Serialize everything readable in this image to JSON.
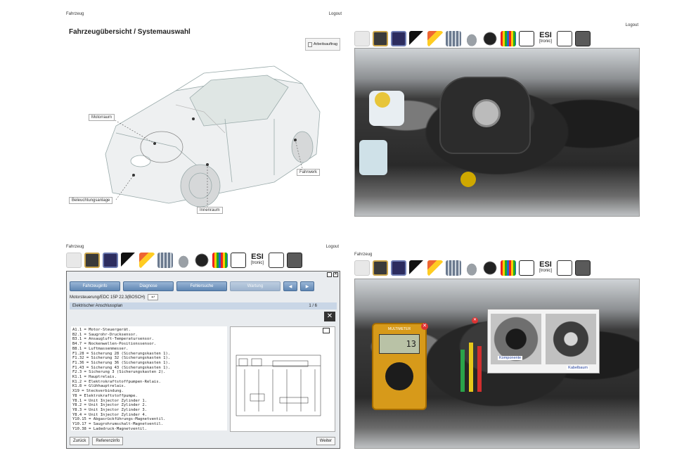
{
  "topleft": {
    "nav_left": "Fahrzeug",
    "nav_right": "Logout",
    "title": "Fahrzeugübersicht / Systemauswahl",
    "order_button": "Arbeitsauftrag",
    "labels": {
      "engine": "Motorraum",
      "lighting": "Beleuchtungsanlage",
      "interior": "Innenraum",
      "chassis": "Fahrwerk"
    }
  },
  "topright": {
    "nav_right": "Logout"
  },
  "bottomleft": {
    "nav_left": "Fahrzeug",
    "nav_right": "Logout",
    "tabs": [
      "Fahrzeuginfo",
      "Diagnose",
      "Fehlersuche",
      "Wartung"
    ],
    "module": "Motorsteuerung/EDC 15P 22.3(BOSCH)",
    "section": "Elektrischer Anschlussplan",
    "page": "1 / 6",
    "legend": [
      "A1.1 = Motor-Steuergerät.",
      "B2.1 = Saugrohr-Drucksensor.",
      "B3.1 = Ansaugluft-Temperatursensor.",
      "B4.7 = Nockenwellen-Positionssensor.",
      "B8.1 = Luftmassenmesser.",
      "F1.28 = Sicherung 28 (Sicherungskasten 1).",
      "F1.32 = Sicherung 32 (Sicherungskasten 1).",
      "F1.36 = Sicherung 36 (Sicherungskasten 1).",
      "F1.43 = Sicherung 43 (Sicherungskasten 1).",
      "F2.3 = Sicherung 3 (Sicherungskasten 2).",
      "K1.1 = Hauptrelais.",
      "K1.2 = Elektrokraftstoffpumpen-Relais.",
      "K1.8 = Glühhauptrelais.",
      "X19 = Steckverbindung.",
      "Y8 = Elektrokraftstoffpumpe.",
      "Y8.1 = Unit Injector Zylinder 1.",
      "Y8.2 = Unit Injector Zylinder 2.",
      "Y8.3 = Unit Injector Zylinder 3.",
      "Y8.4 = Unit Injector Zylinder 4.",
      "Y10.15 = Abgasrückführungs-Magnetventil.",
      "Y10.17 = Saugrohrumschalt-Magnetventil.",
      "Y10.38 = Ladedruck-Magnetventil."
    ],
    "back_button": "Zurück",
    "reference_button": "Referenzinfo",
    "next_button": "Weiter"
  },
  "bottomright": {
    "nav_left": "Fahrzeug",
    "multimeter_label": "MULTIMETER",
    "multimeter_value": "13",
    "component_label": "Komponente",
    "harness_label": "Kabelbaum"
  },
  "icons": [
    "tool-icon",
    "device-icon",
    "scope-icon",
    "probe-icon",
    "pen-icon",
    "keypad-icon",
    "car-icon",
    "dial-icon",
    "fuse-icon",
    "battery-icon",
    "esi-icon",
    "diagram-icon",
    "calculator-icon"
  ],
  "esi": {
    "main": "ESI",
    "sub": "[tronic]"
  }
}
